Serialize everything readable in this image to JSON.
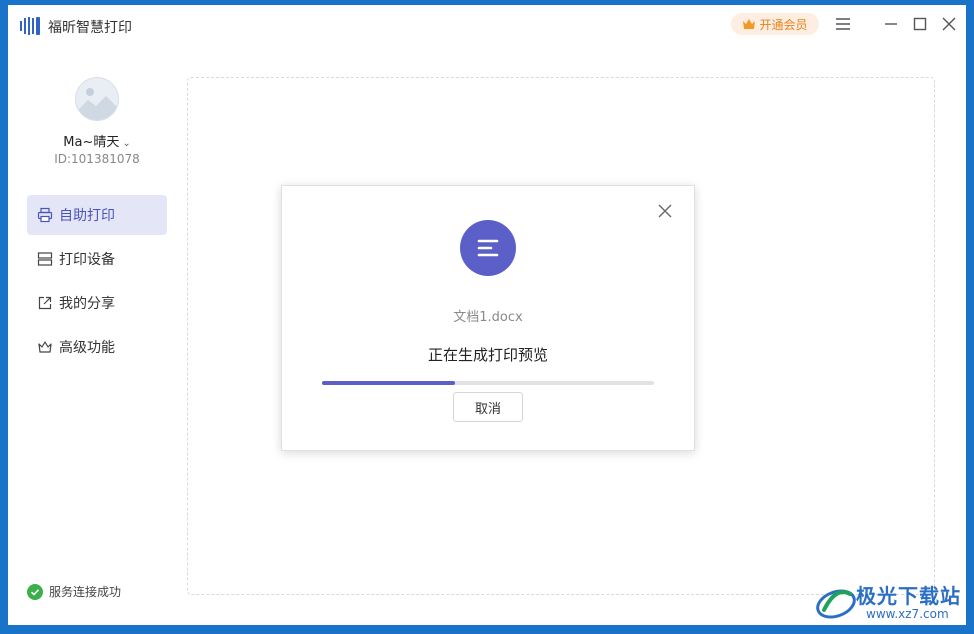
{
  "app": {
    "title": "福昕智慧打印",
    "vip_label": "开通会员"
  },
  "user": {
    "name": "Ma~晴天",
    "id": "ID:101381078"
  },
  "sidebar": {
    "items": [
      {
        "label": "自助打印",
        "icon": "printer-icon",
        "active": true
      },
      {
        "label": "打印设备",
        "icon": "device-icon",
        "active": false
      },
      {
        "label": "我的分享",
        "icon": "share-icon",
        "active": false
      },
      {
        "label": "高级功能",
        "icon": "crown-icon",
        "active": false
      }
    ],
    "status": "服务连接成功"
  },
  "dialog": {
    "file_name": "文档1.docx",
    "message": "正在生成打印预览",
    "progress": 0.4,
    "cancel_label": "取消"
  },
  "watermark": {
    "line1": "极光下载站",
    "line2": "www.xz7.com"
  },
  "colors": {
    "accent": "#5b5fc7",
    "vip": "#e8831d",
    "success": "#3bb04a",
    "desktop": "#1873c9"
  }
}
